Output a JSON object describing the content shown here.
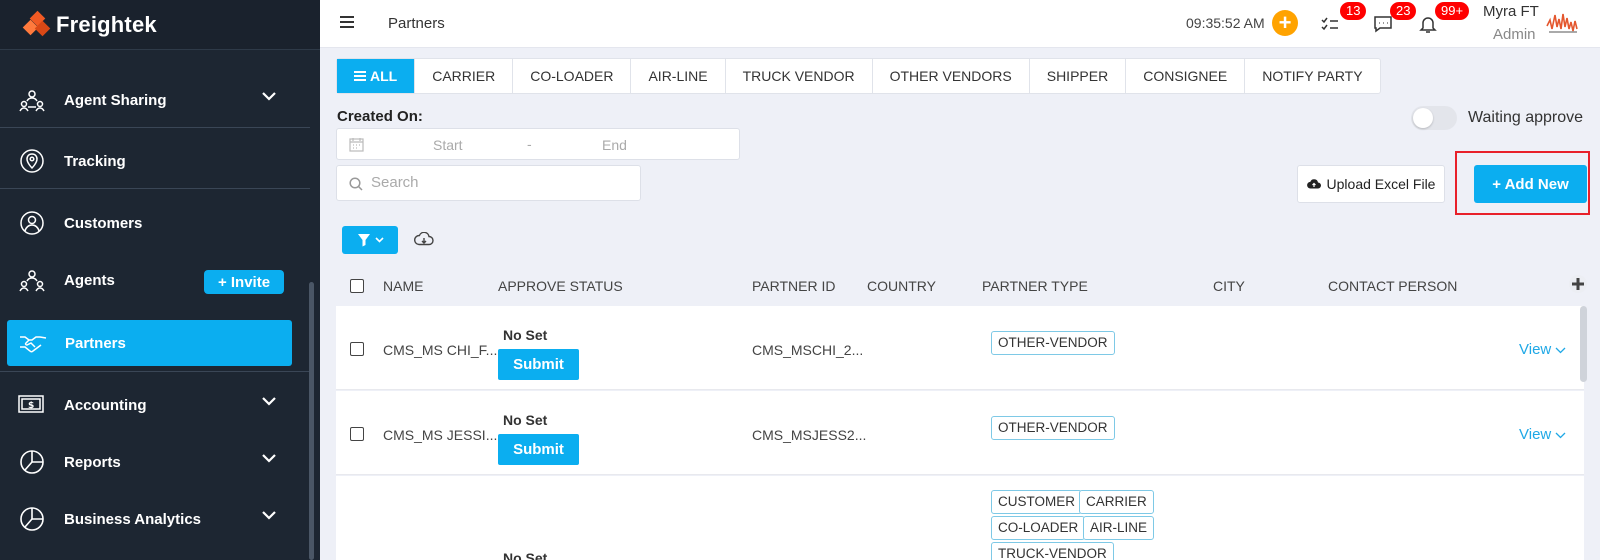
{
  "brand": {
    "name": "Freightek"
  },
  "sidebar": {
    "items": [
      {
        "label": "Agent Sharing",
        "icon": "agent-sharing-icon",
        "expandable": true
      },
      {
        "label": "Tracking",
        "icon": "location-pin-icon",
        "expandable": false
      },
      {
        "label": "Customers",
        "icon": "customer-icon",
        "expandable": false
      },
      {
        "label": "Agents",
        "icon": "agents-icon",
        "expandable": false
      },
      {
        "label": "Partners",
        "icon": "handshake-icon",
        "expandable": false,
        "active": true
      },
      {
        "label": "Accounting",
        "icon": "invoice-icon",
        "expandable": true
      },
      {
        "label": "Reports",
        "icon": "pie-chart-icon",
        "expandable": true
      },
      {
        "label": "Business Analytics",
        "icon": "pie-chart-icon",
        "expandable": true
      }
    ],
    "invite_label": "+ Invite"
  },
  "topbar": {
    "title": "Partners",
    "time": "09:35:52 AM",
    "tasks_count": "13",
    "messages_count": "23",
    "notifications_count": "99+",
    "user_name": "Myra FT",
    "user_role": "Admin"
  },
  "tabs": [
    {
      "label": "ALL",
      "active": true
    },
    {
      "label": "CARRIER"
    },
    {
      "label": "CO-LOADER"
    },
    {
      "label": "AIR-LINE"
    },
    {
      "label": "TRUCK VENDOR"
    },
    {
      "label": "OTHER VENDORS"
    },
    {
      "label": "SHIPPER"
    },
    {
      "label": "CONSIGNEE"
    },
    {
      "label": "NOTIFY PARTY"
    }
  ],
  "filters": {
    "created_on_label": "Created On:",
    "start_placeholder": "Start",
    "separator": "-",
    "end_placeholder": "End",
    "search_placeholder": "Search",
    "waiting_approve_label": "Waiting approve",
    "waiting_approve_on": false
  },
  "actions": {
    "upload_label": "Upload Excel File",
    "add_new_label": "+ Add New"
  },
  "table": {
    "columns": [
      "NAME",
      "APPROVE STATUS",
      "PARTNER ID",
      "COUNTRY",
      "PARTNER TYPE",
      "CITY",
      "CONTACT PERSON"
    ],
    "rows": [
      {
        "name": "CMS_MS CHI_F...",
        "status": "No Set",
        "action": "Submit",
        "partner_id": "CMS_MSCHI_2...",
        "country": "",
        "types": [
          "OTHER-VENDOR"
        ],
        "city": "",
        "contact": "",
        "view": "View"
      },
      {
        "name": "CMS_MS JESSI...",
        "status": "No Set",
        "action": "Submit",
        "partner_id": "CMS_MSJESS2...",
        "country": "",
        "types": [
          "OTHER-VENDOR"
        ],
        "city": "",
        "contact": "",
        "view": "View"
      },
      {
        "name": "",
        "status": "No Set",
        "action": "",
        "partner_id": "",
        "country": "",
        "types": [
          "CUSTOMER",
          "CARRIER",
          "CO-LOADER",
          "AIR-LINE",
          "TRUCK-VENDOR"
        ],
        "city": "",
        "contact": "",
        "view": ""
      }
    ]
  },
  "colors": {
    "accent": "#0baef0",
    "sidebar_bg": "#1d2632",
    "badge": "#ff0000",
    "highlight_outline": "#e8202a",
    "orange": "#ffa300"
  }
}
